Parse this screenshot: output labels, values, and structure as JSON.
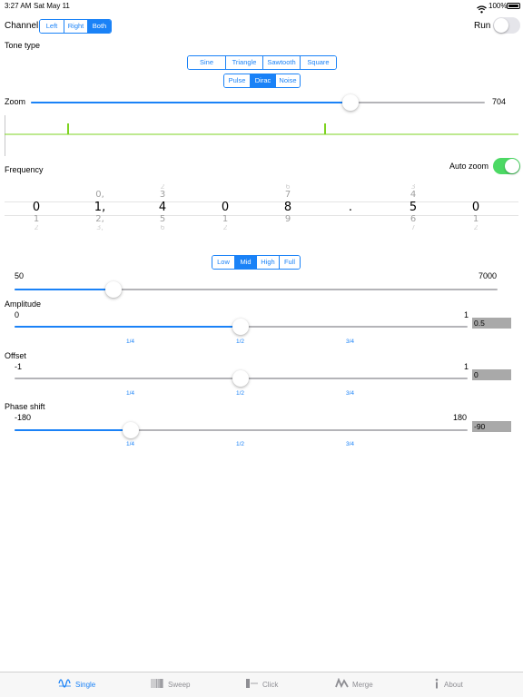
{
  "status": {
    "time": "3:27 AM",
    "date": "Sat May 11",
    "battery": "100%"
  },
  "channel": {
    "label": "Channel",
    "options": [
      "Left",
      "Right",
      "Both"
    ],
    "selected": "Both"
  },
  "run": {
    "label": "Run",
    "on": false
  },
  "tone_type": {
    "label": "Tone type",
    "row1": [
      "Sine",
      "Triangle",
      "Sawtooth",
      "Square"
    ],
    "row2": [
      "Pulse",
      "Dirac",
      "Noise"
    ],
    "selected": "Dirac"
  },
  "zoom": {
    "label": "Zoom",
    "value": "704",
    "fraction": 0.73
  },
  "frequency": {
    "label": "Frequency",
    "auto_zoom_label": "Auto zoom",
    "auto_zoom_on": true,
    "wheels": [
      {
        "up2": "",
        "up1": "",
        "cur": "0",
        "dn1": "1",
        "dn2": "2"
      },
      {
        "up2": "",
        "up1": "0,",
        "cur": "1,",
        "dn1": "2,",
        "dn2": "3,"
      },
      {
        "up2": "2",
        "up1": "3",
        "cur": "4",
        "dn1": "5",
        "dn2": "6"
      },
      {
        "up2": "",
        "up1": "",
        "cur": "0",
        "dn1": "1",
        "dn2": "2"
      },
      {
        "up2": "6",
        "up1": "7",
        "cur": "8",
        "dn1": "9",
        "dn2": ""
      },
      {
        "up2": "",
        "up1": "",
        "cur": ".",
        "dn1": "",
        "dn2": ""
      },
      {
        "up2": "3",
        "up1": "4",
        "cur": "5",
        "dn1": "6",
        "dn2": "7"
      },
      {
        "up2": "",
        "up1": "",
        "cur": "0",
        "dn1": "1",
        "dn2": "2"
      }
    ],
    "range_options": [
      "Low",
      "Mid",
      "High",
      "Full"
    ],
    "range_selected": "Mid",
    "min": "50",
    "max": "7000",
    "slider_fraction": 0.22
  },
  "amplitude": {
    "label": "Amplitude",
    "min": "0",
    "max": "1",
    "value": "0.5",
    "fraction": 0.5,
    "marks": [
      "1/4",
      "1/2",
      "3/4"
    ]
  },
  "offset": {
    "label": "Offset",
    "min": "-1",
    "max": "1",
    "value": "0",
    "fraction": 0.5,
    "marks": [
      "1/4",
      "1/2",
      "3/4"
    ]
  },
  "phase_shift": {
    "label": "Phase shift",
    "min": "-180",
    "max": "180",
    "value": "-90",
    "fraction": 0.25,
    "marks": [
      "1/4",
      "1/2",
      "3/4"
    ]
  },
  "tabs": [
    {
      "label": "Single",
      "icon": "waveform-icon",
      "active": true
    },
    {
      "label": "Sweep",
      "icon": "sweep-icon",
      "active": false
    },
    {
      "label": "Click",
      "icon": "click-icon",
      "active": false
    },
    {
      "label": "Merge",
      "icon": "merge-icon",
      "active": false
    },
    {
      "label": "About",
      "icon": "info-icon",
      "active": false
    }
  ],
  "colors": {
    "accent": "#1a82f7",
    "toggle_on": "#4cd964",
    "waveform": "#7ed321",
    "value_box": "#a9a9a9"
  }
}
